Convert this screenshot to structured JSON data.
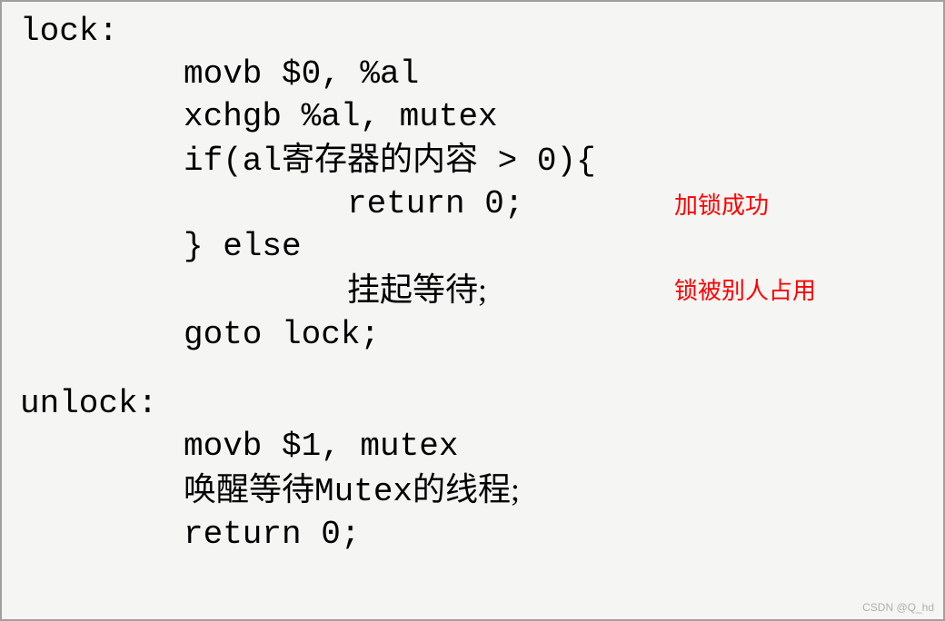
{
  "code": {
    "lock_label": "lock:",
    "line1": "movb $0, %al",
    "line2": "xchgb %al, mutex",
    "line3_prefix": "if(al",
    "line3_cn": "寄存器的内容",
    "line3_suffix": " > 0){",
    "line4": "return 0;",
    "line5": "} else",
    "line6_cn": "挂起等待;",
    "line7": "goto lock;",
    "unlock_label": "unlock:",
    "line8": "movb $1, mutex",
    "line9_cn_prefix": "唤醒等待",
    "line9_mid": "Mutex",
    "line9_cn_suffix": "的线程;",
    "line10": "return 0;"
  },
  "annotations": {
    "success": "加锁成功",
    "occupied": "锁被别人占用"
  },
  "watermark": "CSDN @Q_hd"
}
